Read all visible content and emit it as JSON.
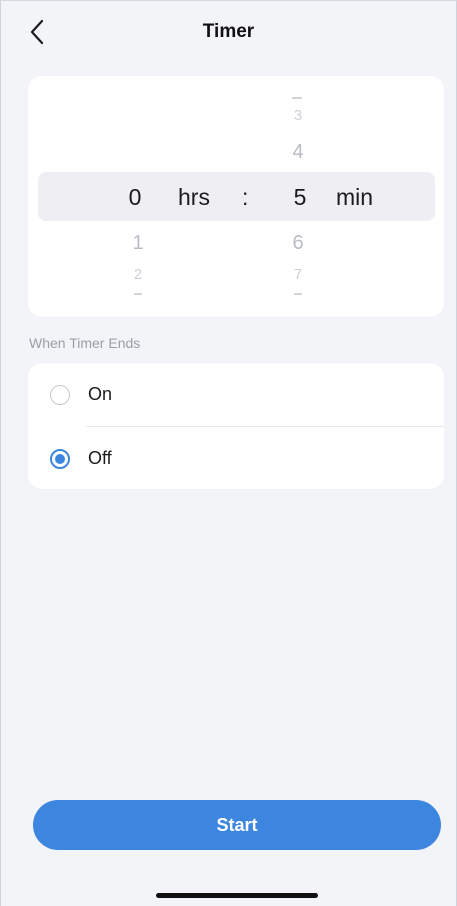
{
  "header": {
    "title": "Timer",
    "back_icon": "chevron-left-icon"
  },
  "picker": {
    "hours_column": {
      "above": [],
      "selected": "0",
      "below": [
        "1",
        "2"
      ]
    },
    "hours_unit": "hrs",
    "separator": ":",
    "minutes_column": {
      "above": [
        "3",
        "4"
      ],
      "selected": "5",
      "below": [
        "6",
        "7"
      ]
    },
    "minutes_unit": "min"
  },
  "timer_end": {
    "section_label": "When Timer Ends",
    "options": [
      {
        "label": "On",
        "checked": false
      },
      {
        "label": "Off",
        "checked": true
      }
    ]
  },
  "actions": {
    "start_label": "Start"
  },
  "colors": {
    "accent": "#3d86e0",
    "background": "#f3f4f8",
    "card": "#ffffff"
  }
}
